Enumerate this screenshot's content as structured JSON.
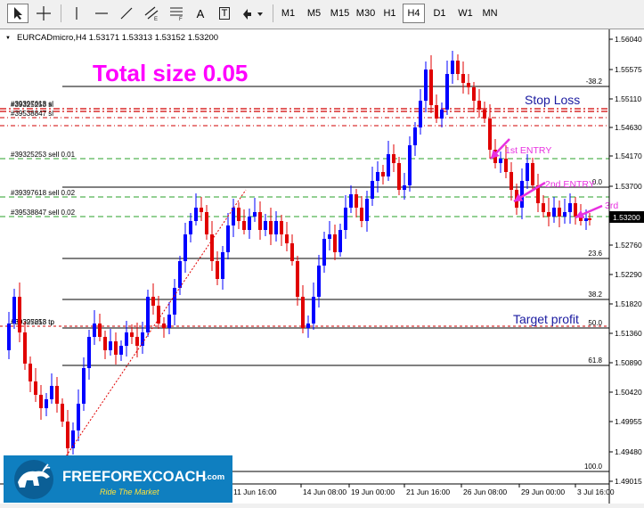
{
  "toolbar": {
    "timeframes": [
      "M1",
      "M5",
      "M15",
      "M30",
      "H1",
      "H4",
      "D1",
      "W1",
      "MN"
    ],
    "active_timeframe": "H4",
    "text_tool": "A",
    "label_tool": "T"
  },
  "chart": {
    "info": "EURCADmicro,H4  1.53171 1.53313 1.53152 1.53200",
    "annotation_title": "Total size 0.05",
    "current_price": "1.53200",
    "price_axis": [
      "1.56040",
      "1.55575",
      "1.55110",
      "1.54630",
      "1.54170",
      "1.53700",
      "1.53200",
      "1.52760",
      "1.52290",
      "1.51820",
      "1.51360",
      "1.50890",
      "1.50420",
      "1.49955",
      "1.49480",
      "1.49015"
    ],
    "time_axis": [
      "11 Jun 16:00",
      "14 Jun 08:00",
      "19 Jun 00:00",
      "21 Jun 16:00",
      "26 Jun 08:00",
      "29 Jun 00:00",
      "3 Jul 16:00"
    ],
    "fib_levels": [
      "-38.2",
      "0.0",
      "23.6",
      "38.2",
      "50.0",
      "61.8",
      "100.0"
    ],
    "order_labels": {
      "sl_1": "#39325253 sl",
      "sl_2": "#39397618 sl",
      "sl_3": "#39538847 sl",
      "sell_1": "#39325253 sell 0.01",
      "sell_2": "#39397618 sell 0.02",
      "sell_3": "#39538847 sell 0.02",
      "tp": "#39325253 tp",
      "tp_overlap": "#39397618 tp"
    },
    "annotations": {
      "stop_loss": "Stop Loss",
      "target_profit": "Target profit",
      "entry_1": "1st ENTRY",
      "entry_2": "2nd ENTRY",
      "entry_3": "3rd"
    }
  },
  "logo": {
    "brand": "FREEFOREXCOACH",
    "domain": ".com",
    "tagline": "Ride The Market"
  },
  "colors": {
    "bull": "#0000ff",
    "bear": "#e00000",
    "entry": "#e830e0",
    "title": "#ff00ff",
    "sl_line": "#d00000",
    "entry_line": "#2aa02a",
    "annotation": "#1a1aa0",
    "logo_bg": "#0f7fc0"
  }
}
